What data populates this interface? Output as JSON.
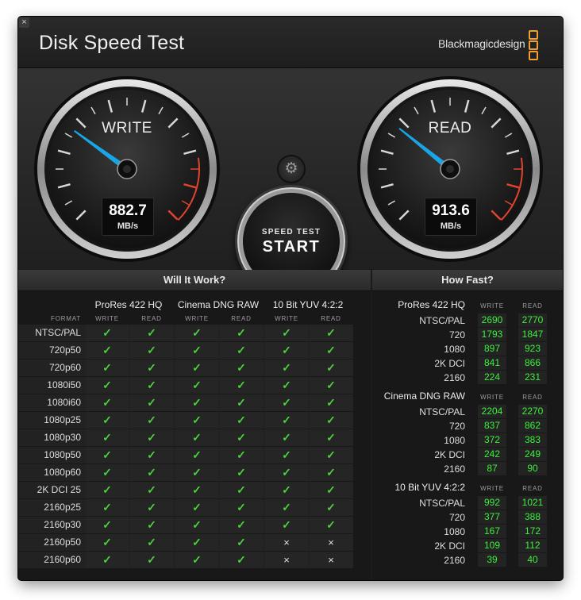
{
  "window": {
    "title": "Disk Speed Test",
    "brand": "Blackmagicdesign",
    "close_glyph": "×"
  },
  "gauges": {
    "write": {
      "label": "WRITE",
      "value": "882.7",
      "unit": "MB/s",
      "needle_fraction": 0.3
    },
    "read": {
      "label": "READ",
      "value": "913.6",
      "unit": "MB/s",
      "needle_fraction": 0.31
    }
  },
  "controls": {
    "settings_icon": "gear-icon",
    "start_line1": "SPEED TEST",
    "start_line2": "START"
  },
  "will_it_work": {
    "title": "Will It Work?",
    "format_label": "FORMAT",
    "write_label": "WRITE",
    "read_label": "READ",
    "groups": [
      "ProRes 422 HQ",
      "Cinema DNG RAW",
      "10 Bit YUV 4:2:2"
    ],
    "check_glyph": "✓",
    "cross_glyph": "×",
    "rows": [
      {
        "format": "NTSC/PAL",
        "ok": [
          true,
          true,
          true,
          true,
          true,
          true
        ]
      },
      {
        "format": "720p50",
        "ok": [
          true,
          true,
          true,
          true,
          true,
          true
        ]
      },
      {
        "format": "720p60",
        "ok": [
          true,
          true,
          true,
          true,
          true,
          true
        ]
      },
      {
        "format": "1080i50",
        "ok": [
          true,
          true,
          true,
          true,
          true,
          true
        ]
      },
      {
        "format": "1080i60",
        "ok": [
          true,
          true,
          true,
          true,
          true,
          true
        ]
      },
      {
        "format": "1080p25",
        "ok": [
          true,
          true,
          true,
          true,
          true,
          true
        ]
      },
      {
        "format": "1080p30",
        "ok": [
          true,
          true,
          true,
          true,
          true,
          true
        ]
      },
      {
        "format": "1080p50",
        "ok": [
          true,
          true,
          true,
          true,
          true,
          true
        ]
      },
      {
        "format": "1080p60",
        "ok": [
          true,
          true,
          true,
          true,
          true,
          true
        ]
      },
      {
        "format": "2K DCI 25",
        "ok": [
          true,
          true,
          true,
          true,
          true,
          true
        ]
      },
      {
        "format": "2160p25",
        "ok": [
          true,
          true,
          true,
          true,
          true,
          true
        ]
      },
      {
        "format": "2160p30",
        "ok": [
          true,
          true,
          true,
          true,
          true,
          true
        ]
      },
      {
        "format": "2160p50",
        "ok": [
          true,
          true,
          true,
          true,
          false,
          false
        ]
      },
      {
        "format": "2160p60",
        "ok": [
          true,
          true,
          true,
          true,
          false,
          false
        ]
      }
    ]
  },
  "how_fast": {
    "title": "How Fast?",
    "write_label": "WRITE",
    "read_label": "READ",
    "groups": [
      {
        "name": "ProRes 422 HQ",
        "rows": [
          {
            "label": "NTSC/PAL",
            "write": "2690",
            "read": "2770"
          },
          {
            "label": "720",
            "write": "1793",
            "read": "1847"
          },
          {
            "label": "1080",
            "write": "897",
            "read": "923"
          },
          {
            "label": "2K DCI",
            "write": "841",
            "read": "866"
          },
          {
            "label": "2160",
            "write": "224",
            "read": "231"
          }
        ]
      },
      {
        "name": "Cinema DNG RAW",
        "rows": [
          {
            "label": "NTSC/PAL",
            "write": "2204",
            "read": "2270"
          },
          {
            "label": "720",
            "write": "837",
            "read": "862"
          },
          {
            "label": "1080",
            "write": "372",
            "read": "383"
          },
          {
            "label": "2K DCI",
            "write": "242",
            "read": "249"
          },
          {
            "label": "2160",
            "write": "87",
            "read": "90"
          }
        ]
      },
      {
        "name": "10 Bit YUV 4:2:2",
        "rows": [
          {
            "label": "NTSC/PAL",
            "write": "992",
            "read": "1021"
          },
          {
            "label": "720",
            "write": "377",
            "read": "388"
          },
          {
            "label": "1080",
            "write": "167",
            "read": "172"
          },
          {
            "label": "2K DCI",
            "write": "109",
            "read": "112"
          },
          {
            "label": "2160",
            "write": "39",
            "read": "40"
          }
        ]
      }
    ]
  },
  "colors": {
    "window_bg": "#1b1b1b",
    "needle": "#19a6e6",
    "redline": "#e2432e",
    "check_green": "#4bd23c",
    "fast_green": "#3cf03c",
    "brand_orange": "#f0a032"
  }
}
